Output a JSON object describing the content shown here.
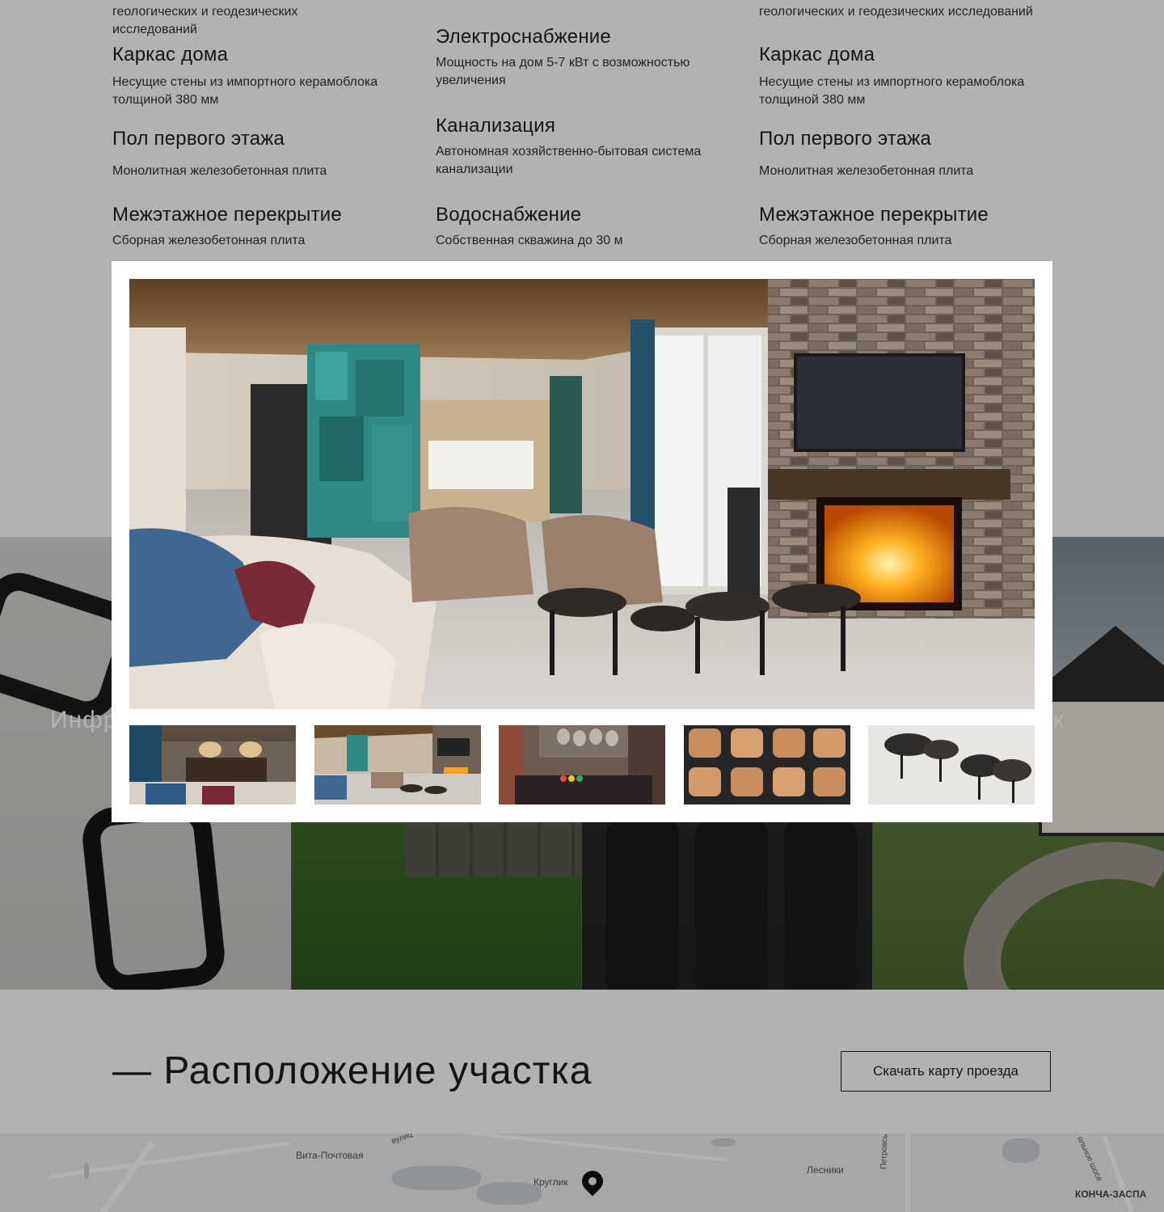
{
  "specs": {
    "col1": {
      "top_fragment": "геологических и геодезических исследований",
      "items": [
        {
          "title": "Каркас дома",
          "text": "Несущие стены из импортного керамоблока толщиной 380 мм"
        },
        {
          "title": "Пол первого этажа",
          "text": "Монолитная железобетонная плита"
        },
        {
          "title": "Межэтажное перекрытие",
          "text": "Сборная железобетонная плита"
        }
      ]
    },
    "col2": {
      "items": [
        {
          "title": "Электроснабжение",
          "text": "Мощность на дом 5-7 кВт с возможностью увеличения"
        },
        {
          "title": "Канализация",
          "text": "Автономная хозяйственно-бытовая система канализации"
        },
        {
          "title": "Водоснабжение",
          "text": "Собственная скважина до 30 м"
        }
      ]
    },
    "col3": {
      "top_fragment": "геологических и геодезических исследований",
      "items": [
        {
          "title": "Каркас дома",
          "text": "Несущие стены из импортного керамоблока толщиной 380 мм"
        },
        {
          "title": "Пол первого этажа",
          "text": "Монолитная железобетонная плита"
        },
        {
          "title": "Межэтажное перекрытие",
          "text": "Сборная железобетонная плита"
        }
      ]
    }
  },
  "info": {
    "title_left": "Инфр",
    "title_right": "к"
  },
  "location": {
    "title": "— Расположение участка",
    "button": "Скачать карту проезда"
  },
  "map": {
    "labels": [
      "Вита-Почтовая",
      "Круглик",
      "Лесники",
      "КОНЧА-ЗАСПА",
      "Петровське шосе",
      "ольное шосе",
      "вулиц"
    ]
  },
  "lightbox": {
    "main_image": "living-room-fireplace",
    "thumbnails": [
      "dining-sideboard",
      "living-room-fireplace",
      "dining-room",
      "wooden-wall-decor",
      "wood-stools"
    ]
  },
  "colors": {
    "overlay": "#000000",
    "lightbox_bg": "#ffffff",
    "text": "#1e1e1e"
  }
}
